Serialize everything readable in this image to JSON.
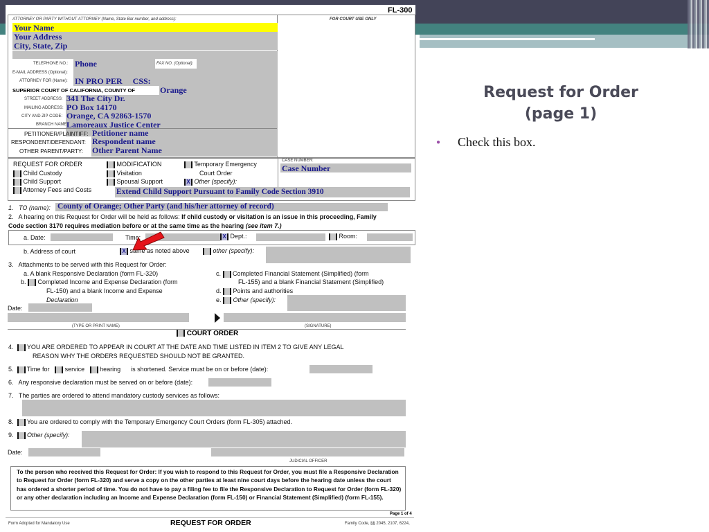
{
  "slide": {
    "title_line1": "Request for Order",
    "title_line2": "(page 1)",
    "bullet": "Check this box.",
    "colors": {
      "header_dark": "#434458",
      "teal": "#43827f",
      "light_teal": "#a5bfc3",
      "bullet": "#9b4fa8",
      "arrow": "#e5141b"
    }
  },
  "form": {
    "form_id": "FL-300",
    "attorney_label": "ATTORNEY OR PARTY WITHOUT ATTORNEY (Name, State Bar number, and address):",
    "court_use_label": "FOR COURT USE ONLY",
    "name": "Your Name",
    "address": "Your Address",
    "city_state_zip": "City, State, Zip",
    "telephone_label": "TELEPHONE NO.:",
    "telephone": "Phone",
    "fax_label": "FAX NO. (Optional):",
    "email_label": "E-MAIL ADDRESS (Optional):",
    "attorney_for_label": "ATTORNEY FOR (Name):",
    "attorney_for": "IN PRO PER     CSS:",
    "court_label": "SUPERIOR COURT OF CALIFORNIA, COUNTY OF",
    "county": "Orange",
    "street_label": "STREET ADDRESS:",
    "street": "341 The City Dr.",
    "mailing_label": "MAILING ADDRESS:",
    "mailing": "PO Box 14170",
    "cityzip_label": "CITY AND ZIP CODE:",
    "cityzip": "Orange, CA  92863-1570",
    "branch_label": "BRANCH NAME:",
    "branch": "Lamoreaux Justice Center",
    "petitioner_label": "PETITIONER/PLAINTIFF:",
    "petitioner": "Petitioner name",
    "respondent_label": "RESPONDENT/DEFENDANT:",
    "respondent": "Respondent name",
    "other_parent_label": "OTHER PARENT/PARTY:",
    "other_parent": "Other Parent Name",
    "rfo_label": "REQUEST FOR ORDER",
    "modification": "MODIFICATION",
    "temp_emergency_1": "Temporary Emergency",
    "temp_emergency_2": "Court Order",
    "child_custody": "Child Custody",
    "visitation": "Visitation",
    "child_support": "Child Support",
    "spousal_support": "Spousal Support",
    "other_specify": "Other (specify):",
    "attorney_fees": "Attorney Fees and Costs",
    "other_value": "Extend Child Support Pursuant to Family Code Section 3910",
    "case_number_label": "CASE NUMBER:",
    "case_number": "Case Number",
    "checked_mark": "X",
    "item1_label": "1.   TO (name):",
    "item1_value": "County of Orange; Other Party (and his/her attorney of record)",
    "item2_text_a": "2.   A hearing on this Request for Order will be held as follows:",
    "item2_text_b": " If child custody or visitation is an issue in this proceeding, Family",
    "item2_text_c": "Code section 3170 requires mediation before or at the same time as the hearing",
    "item2_text_d": " (see item 7.)",
    "date_label": "a. Date:",
    "time_label": "Time:",
    "dept_label": "Dept.:",
    "room_label": "Room:",
    "address_court_label": "b. Address of court",
    "same_as_above": "same as noted above",
    "other_specify_lc": "other (specify):",
    "item3_label": "3.   Attachments to be served with this Request for Order:",
    "item3a": "a.   A blank Responsive Declaration (form FL-320)",
    "item3b_1": "Completed Income and Expense Declaration (form",
    "item3b_2": "FL-150) and a blank Income and Expense",
    "item3b_3": "Declaration",
    "item3c_1": "Completed Financial Statement (Simplified) (form",
    "item3c_2": "FL-155) and a blank Financial Statement (Simplified)",
    "item3d": "Points and authorities",
    "item3e": "Other (specify):",
    "date_plain": "Date:",
    "type_print_name": "(TYPE OR PRINT NAME)",
    "signature": "(SIGNATURE)",
    "court_order": "COURT ORDER",
    "item4_1": "YOU ARE ORDERED TO APPEAR IN COURT AT THE DATE AND TIME LISTED IN ITEM 2 TO GIVE ANY LEGAL",
    "item4_2": "REASON WHY THE ORDERS REQUESTED SHOULD NOT BE GRANTED.",
    "item5_time_for": "Time for",
    "item5_service": "service",
    "item5_hearing": "hearing",
    "item5_rest": "is shortened. Service must be on or before (date):",
    "item6": "6.   Any responsive declaration must be served on or before (date):",
    "item7": "7.   The parties are ordered to attend mandatory custody services as follows:",
    "item8": "You are ordered to comply with the Temporary Emergency Court Orders (form FL-305) attached.",
    "item9": "Other (specify):",
    "judicial_officer": "JUDICIAL OFFICER",
    "notice": "To the person who received this Request for Order: If you wish to respond to this Request for Order, you must file a Responsive Declaration to Request for Order (form FL-320) and serve a copy on the other parties at least nine court days before the hearing date unless the court has ordered a shorter period of time. You do not have to pay a filing fee to file the Responsive Declaration to Request for Order (form FL-320) or any other declaration including an Income and Expense Declaration (form FL-150) or Financial Statement (Simplified) (form FL-155).",
    "page_of": "Page 1 of 4",
    "footer_left": "Form Adopted for Mandatory Use",
    "footer_title": "REQUEST FOR ORDER",
    "footer_right": "Family Code, §§ 2045, 2107, 6224,",
    "n4": "4.",
    "n5": "5.",
    "n8": "8.",
    "n9": "9.",
    "b_prefix": "b.",
    "c_prefix": "c.",
    "d_prefix": "d.",
    "e_prefix": "e."
  }
}
